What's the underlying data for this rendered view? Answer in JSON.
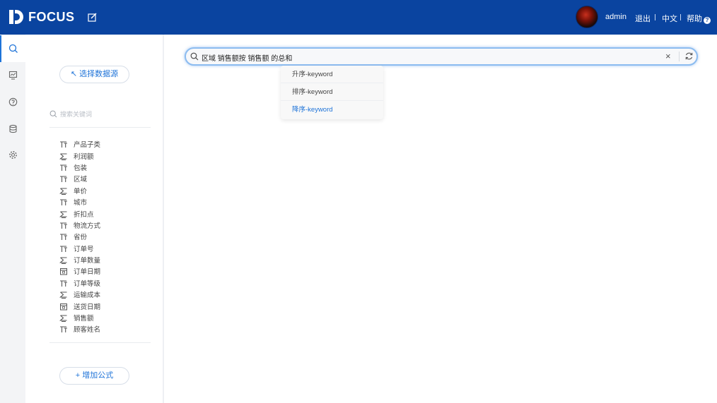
{
  "header": {
    "brand": "FOCUS",
    "user": "admin",
    "links": {
      "logout": "退出",
      "language": "中文",
      "help": "帮助"
    },
    "help_mark": "?"
  },
  "rail": {
    "items": [
      "search-icon",
      "dashboard-icon",
      "help-icon",
      "database-icon",
      "settings-icon"
    ]
  },
  "panel": {
    "select_source": "↖ 选择数据源",
    "search_placeholder": "搜索关键词",
    "fields": [
      {
        "label": "产品子类",
        "type": "text"
      },
      {
        "label": "利润额",
        "type": "number"
      },
      {
        "label": "包装",
        "type": "text"
      },
      {
        "label": "区域",
        "type": "text"
      },
      {
        "label": "单价",
        "type": "number"
      },
      {
        "label": "城市",
        "type": "text"
      },
      {
        "label": "折扣点",
        "type": "number"
      },
      {
        "label": "物流方式",
        "type": "text"
      },
      {
        "label": "省份",
        "type": "text"
      },
      {
        "label": "订单号",
        "type": "text"
      },
      {
        "label": "订单数量",
        "type": "number"
      },
      {
        "label": "订单日期",
        "type": "date"
      },
      {
        "label": "订单等级",
        "type": "text"
      },
      {
        "label": "运输成本",
        "type": "number"
      },
      {
        "label": "送货日期",
        "type": "date"
      },
      {
        "label": "销售额",
        "type": "number"
      },
      {
        "label": "顾客姓名",
        "type": "text"
      }
    ],
    "add_formula": "+ 增加公式"
  },
  "search": {
    "query": "区域 销售额按 销售额 的总和",
    "clear": "×"
  },
  "suggestions": [
    {
      "label": "升序-keyword"
    },
    {
      "label": "排序-keyword"
    },
    {
      "label": "降序-keyword"
    }
  ],
  "colors": {
    "header": "#0a44a0",
    "accent": "#1e73d8"
  }
}
